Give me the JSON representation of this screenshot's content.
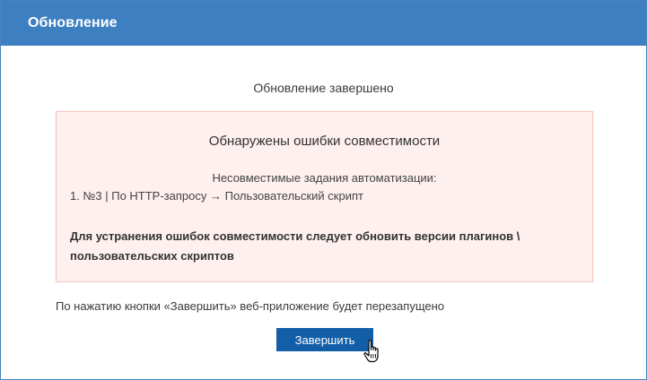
{
  "dialog": {
    "title": "Обновление",
    "status": "Обновление завершено",
    "error_box": {
      "heading": "Обнаружены ошибки совместимости",
      "subheading": "Несовместимые задания автоматизации:",
      "tasks": [
        "1. №3 | По HTTP-запросу → Пользовательский скрипт"
      ],
      "advice": "Для устранения ошибок совместимости следует обновить версии плагинов \\ пользовательских скриптов"
    },
    "restart_note": "По нажатию кнопки «Завершить» веб-приложение будет перезапущено",
    "finish_button": "Завершить"
  },
  "colors": {
    "titlebar": "#3d7fc0",
    "button": "#125fa8",
    "error_bg": "#fdf0ef",
    "error_border": "#f2c3bf"
  },
  "icons": {
    "cursor": "hand-pointer-icon"
  }
}
